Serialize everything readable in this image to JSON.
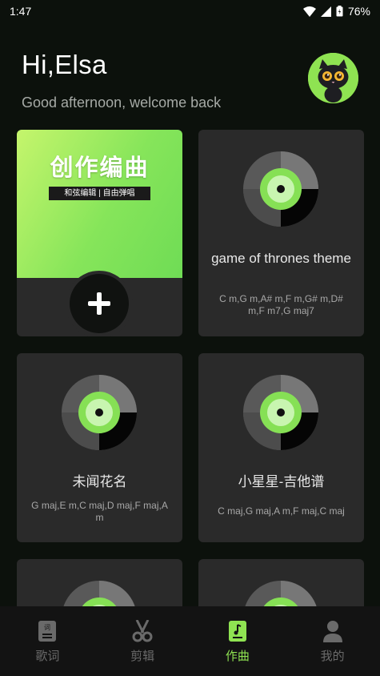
{
  "status_bar": {
    "time": "1:47",
    "battery": "76%"
  },
  "header": {
    "greeting": "Hi,Elsa",
    "subtitle": "Good afternoon, welcome back"
  },
  "create_card": {
    "title": "创作编曲",
    "tag": "和弦编辑 | 自由弹唱"
  },
  "songs": [
    {
      "title": "game of thrones theme",
      "chords": "C m,G m,A# m,F m,G# m,D# m,F m7,G maj7"
    },
    {
      "title": "未闻花名",
      "chords": "G maj,E m,C maj,D maj,F maj,A m"
    },
    {
      "title": "小星星-吉他谱",
      "chords": "C maj,G maj,A m,F maj,C maj"
    }
  ],
  "tabs": [
    {
      "label": "歌词",
      "icon": "lyrics-icon",
      "active": false
    },
    {
      "label": "剪辑",
      "icon": "scissors-icon",
      "active": false
    },
    {
      "label": "作曲",
      "icon": "compose-icon",
      "active": true
    },
    {
      "label": "我的",
      "icon": "profile-icon",
      "active": false
    }
  ],
  "colors": {
    "accent": "#8fe352",
    "card": "#2a2a2a",
    "background": "#0c110c"
  }
}
